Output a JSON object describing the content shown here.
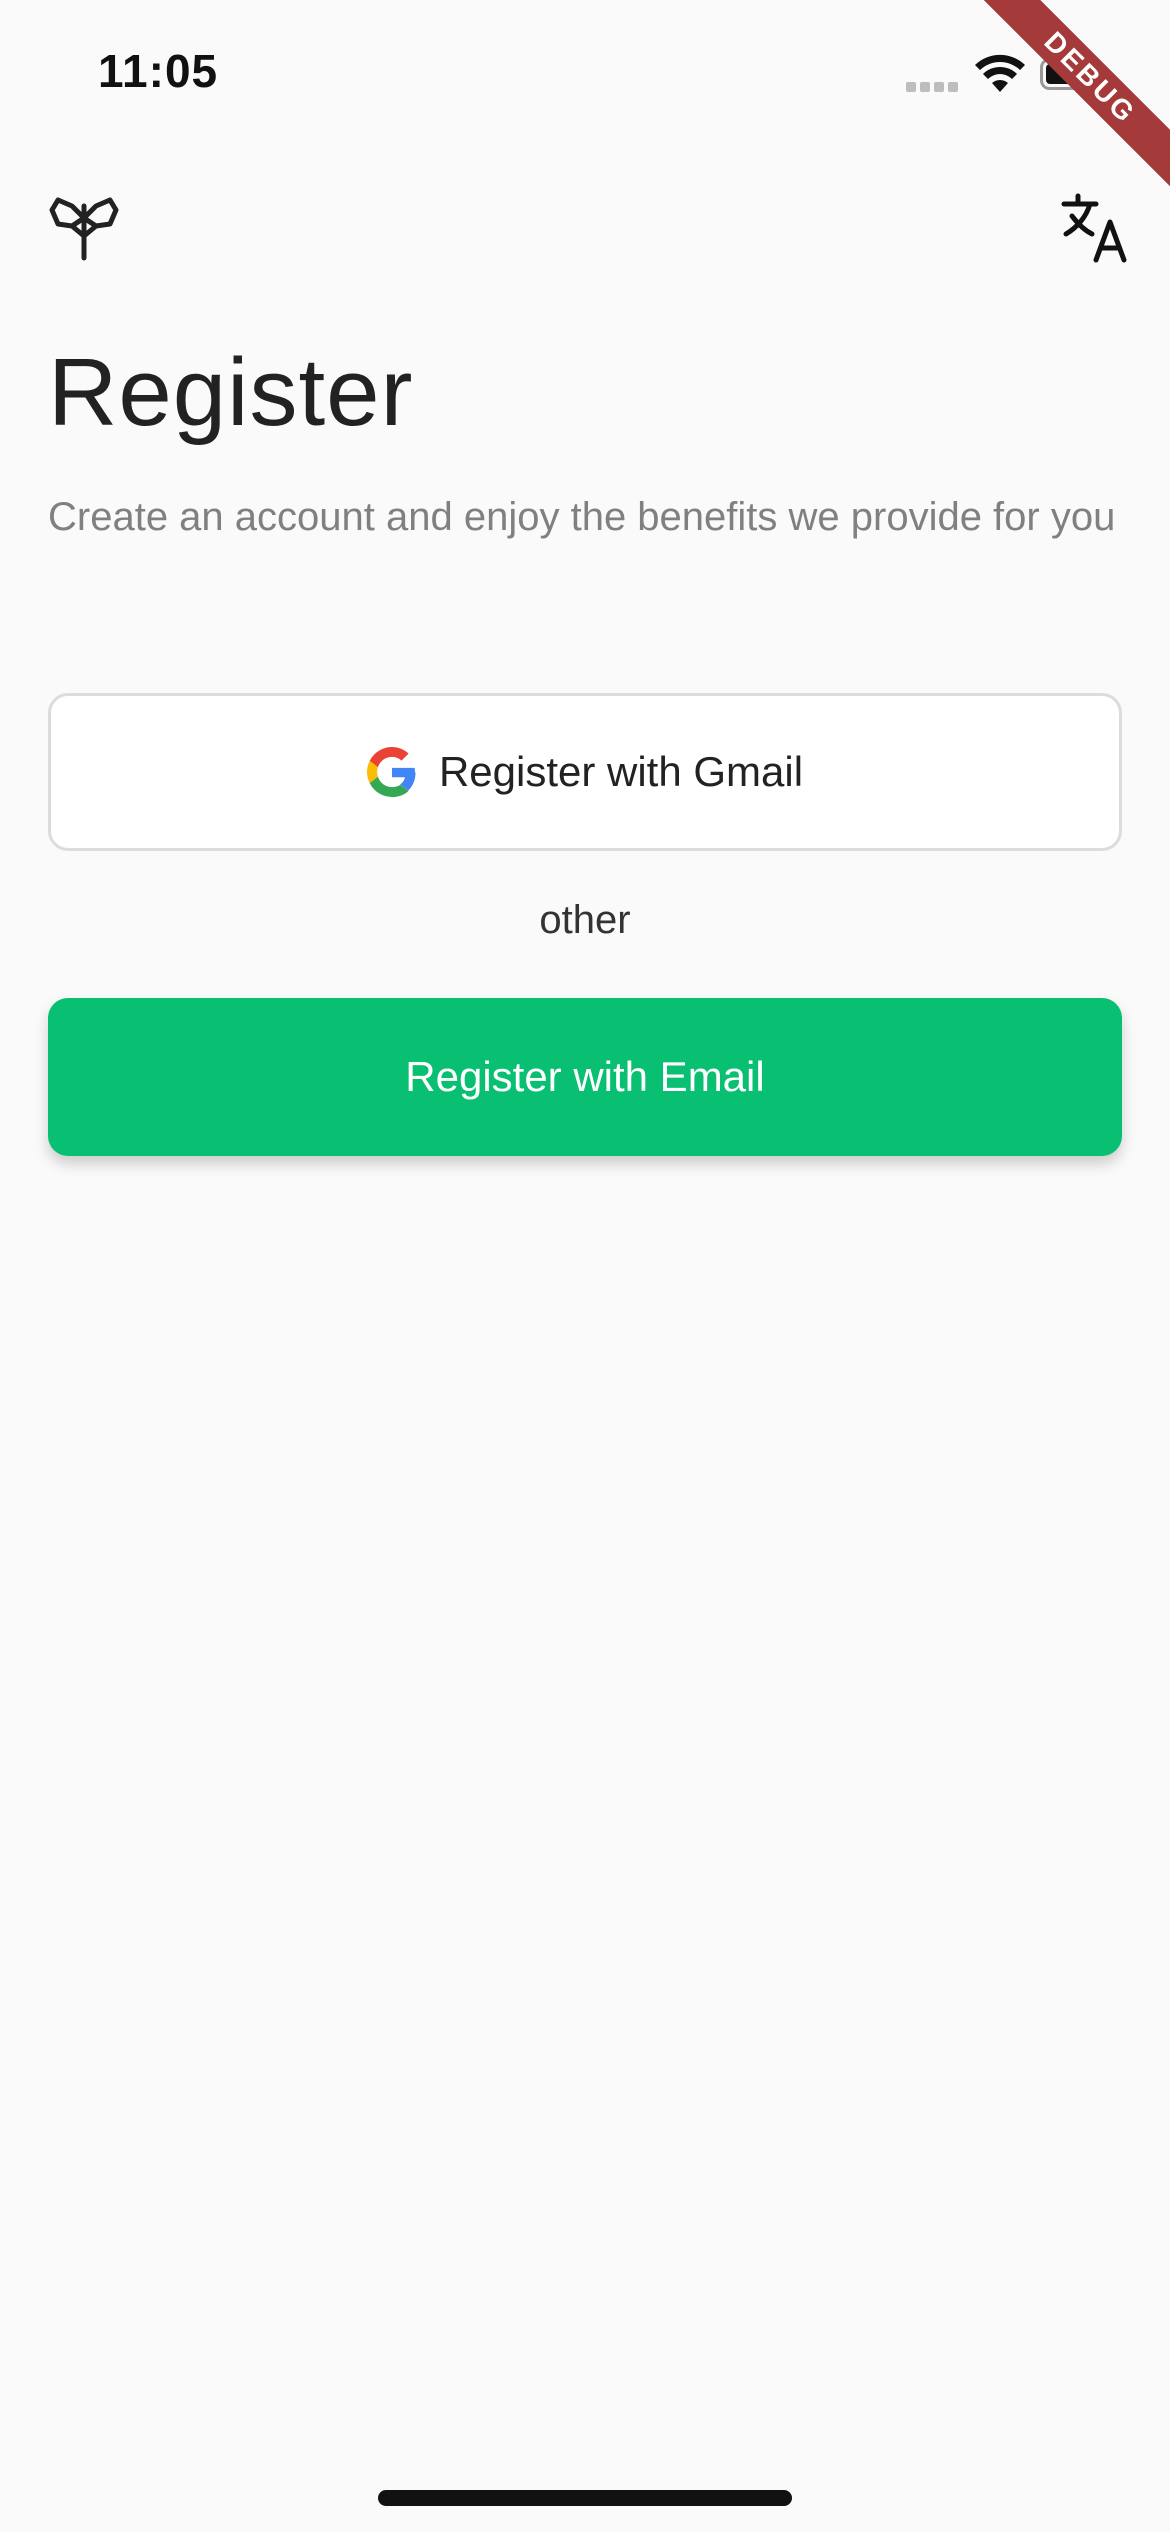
{
  "status_bar": {
    "time": "11:05",
    "icons": [
      "signal-icon",
      "wifi-icon",
      "battery-icon"
    ]
  },
  "debug_banner": {
    "label": "DEBUG",
    "color": "#a53a3a"
  },
  "nav": {
    "left_icon": "logo-icon",
    "right_icon": "translate-icon"
  },
  "page": {
    "title": "Register",
    "subtitle": "Create an account and enjoy the benefits we provide for you"
  },
  "actions": {
    "gmail_label": "Register with Gmail",
    "gmail_icon": "google-icon",
    "divider_label": "other",
    "email_label": "Register with Email"
  },
  "colors": {
    "accent": "#09bf72",
    "background": "#fafafa",
    "border": "#dcdcdc",
    "subtitle": "#808080"
  }
}
